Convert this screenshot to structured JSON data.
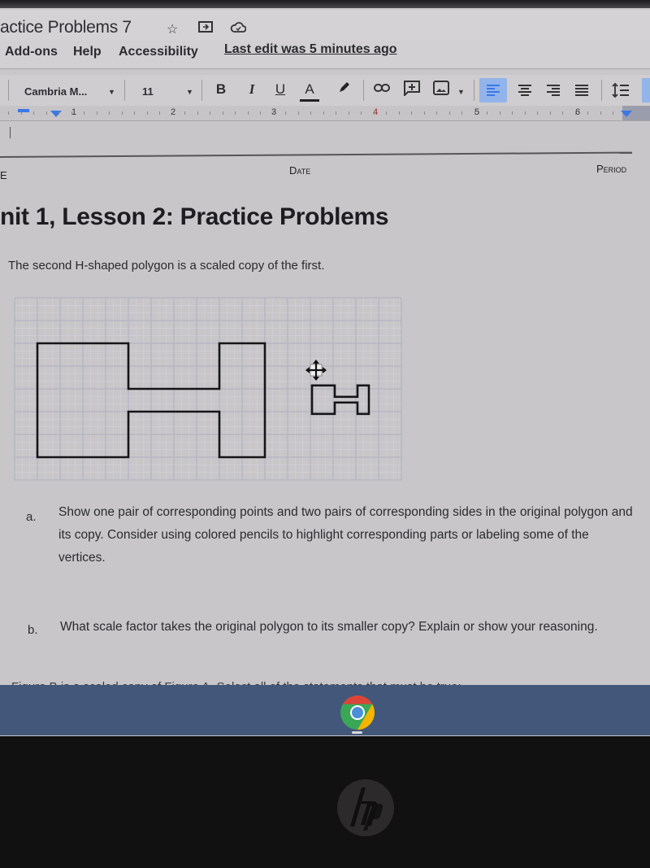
{
  "window": {
    "doc_title": "actice Problems 7",
    "title_icons": [
      "star-icon",
      "move-to-folder-icon",
      "cloud-saved-icon"
    ]
  },
  "menubar": {
    "items": [
      "Add-ons",
      "Help",
      "Accessibility"
    ],
    "last_edit": "Last edit was 5 minutes ago"
  },
  "toolbar": {
    "font_name": "Cambria M...",
    "font_size": "11",
    "bold": "B",
    "italic": "I",
    "underline": "U",
    "text_color": "A",
    "align_left_active": true
  },
  "ruler": {
    "numbers": [
      "1",
      "2",
      "3",
      "4",
      "5",
      "6"
    ]
  },
  "document": {
    "header_name_fragment": "E",
    "header_date": "Date",
    "header_period": "Period",
    "title": "nit 1, Lesson 2: Practice Problems",
    "intro": "The second H-shaped polygon is a scaled copy of the first.",
    "figure": {
      "description": "Two H-shaped polygons on grid paper; the second is a smaller scaled copy",
      "original_polygon_units": {
        "width": 10,
        "height": 5
      },
      "copy_polygon_units": {
        "width": 2.5,
        "height": 1.25
      }
    },
    "questions": [
      {
        "label": "a.",
        "text": "Show one pair of corresponding points and two pairs of corresponding sides in the original polygon and its copy. Consider using colored pencils to highlight corresponding parts or labeling some of the vertices."
      },
      {
        "label": "b.",
        "text": "What scale factor takes the original polygon to its smaller copy? Explain or show your reasoning."
      }
    ],
    "cutoff_text": "Figure B is a scaled copy of Figure A. Select all of the statements that must be true:"
  },
  "shelf": {
    "pinned_apps": [
      "Chrome"
    ],
    "shelf_color": "#43577a"
  },
  "device": {
    "logo": "hp"
  },
  "colors": {
    "accent_blue": "#3b78e7",
    "active_button_bg": "#93b4ea"
  }
}
